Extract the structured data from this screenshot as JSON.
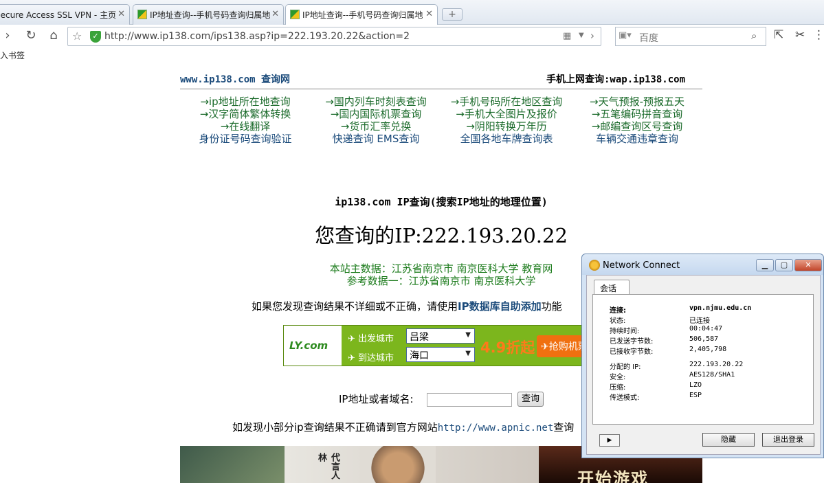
{
  "tabs": [
    {
      "label": "Secure Access SSL VPN - 主页"
    },
    {
      "label": "IP地址查询--手机号码查询归属地"
    },
    {
      "label": "IP地址查询--手机号码查询归属地"
    }
  ],
  "newtab_label": "+",
  "toolbar": {
    "url": "http://www.ip138.com/ips138.asp?ip=222.193.20.22&action=2",
    "search_placeholder": "百度"
  },
  "bookmarks_label": "导入书签",
  "site": {
    "header_left": "www.ip138.com 查询网",
    "header_right": "手机上网查询:wap.ip138.com",
    "links": [
      [
        "→ip地址所在地查询",
        "→国内列车时刻表查询",
        "→手机号码所在地区查询",
        "→天气预报-预报五天"
      ],
      [
        "→汉字简体繁体转换",
        "→国内国际机票查询",
        "→手机大全图片及报价",
        "→五笔编码拼音查询"
      ],
      [
        "→在线翻译",
        "→货币汇率兑换",
        "→阴阳转换万年历",
        "→邮编查询区号查询"
      ],
      [
        "身份证号码查询验证",
        "快递查询 EMS查询",
        "全国各地车牌查询表",
        "车辆交通违章查询"
      ]
    ],
    "heading": "ip138.com IP查询(搜索IP地址的地理位置)",
    "result": "您查询的IP:222.193.20.22",
    "location_main": "本站主数据：江苏省南京市 南京医科大学 教育网",
    "location_ref": "参考数据一：江苏省南京市 南京医科大学",
    "notice_pre": "如果您发现查询结果不详细或不正确，请使用",
    "notice_link": "IP数据库自助添加",
    "notice_post": "功能",
    "ad": {
      "logo": "LY.com",
      "depart_label": "出发城市",
      "depart_value": "吕梁",
      "arrive_label": "到达城市",
      "arrive_value": "海口",
      "discount": "4.9折起",
      "grab": "抢购机票"
    },
    "form_label": "IP地址或者域名:",
    "query_button": "查询",
    "foot_pre": "如发现小部分ip查询结果不正确请到官方网站",
    "foot_url": "http://www.apnic.net",
    "foot_post": "查询",
    "banner_text": "代言人 林",
    "banner_game": "开始游戏"
  },
  "network_connect": {
    "title": "Network Connect",
    "tab": "会话",
    "rows": [
      {
        "key": "连接:",
        "value": "vpn.njmu.edu.cn"
      },
      {
        "key": "状态:",
        "value": "已连接"
      },
      {
        "key": "持续时间:",
        "value": "00:04:47"
      },
      {
        "key": "已发送字节数:",
        "value": "506,587"
      },
      {
        "key": "已接收字节数:",
        "value": "2,405,798"
      },
      {
        "key": "分配的 IP:",
        "value": "222.193.20.22"
      },
      {
        "key": "安全:",
        "value": "AES128/SHA1"
      },
      {
        "key": "压缩:",
        "value": "LZO"
      },
      {
        "key": "传送模式:",
        "value": "ESP"
      }
    ],
    "hide_button": "隐藏",
    "logout_button": "退出登录"
  }
}
